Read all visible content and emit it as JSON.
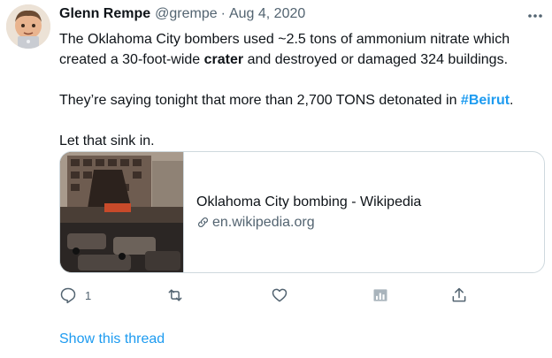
{
  "author": {
    "name": "Glenn Rempe",
    "handle": "@grempe",
    "separator": "·",
    "date": "Aug 4, 2020"
  },
  "tweet": {
    "line1_before": "The Oklahoma City bombers used ~2.5 tons of ammonium nitrate which created a 30-foot-wide ",
    "line1_bold": "crater",
    "line1_after": " and destroyed or damaged 324 buildings.",
    "line2_before": "They’re saying tonight that more than 2,700 TONS detonated in ",
    "line2_hashtag": "#Beirut",
    "line2_after": ".",
    "line3": "Let that sink in."
  },
  "link_card": {
    "title": "Oklahoma City bombing - Wikipedia",
    "domain": "en.wikipedia.org"
  },
  "actions": {
    "reply_count": "1"
  },
  "show_thread_label": "Show this thread",
  "icons": {
    "more": "more-horizontal-icon",
    "reply": "reply-icon",
    "retweet": "retweet-icon",
    "like": "heart-icon",
    "analytics": "analytics-icon",
    "share": "share-icon",
    "link": "link-icon"
  },
  "colors": {
    "text": "#0f1419",
    "secondary": "#536471",
    "accent": "#1d9bf0",
    "border": "#cfd9de"
  }
}
